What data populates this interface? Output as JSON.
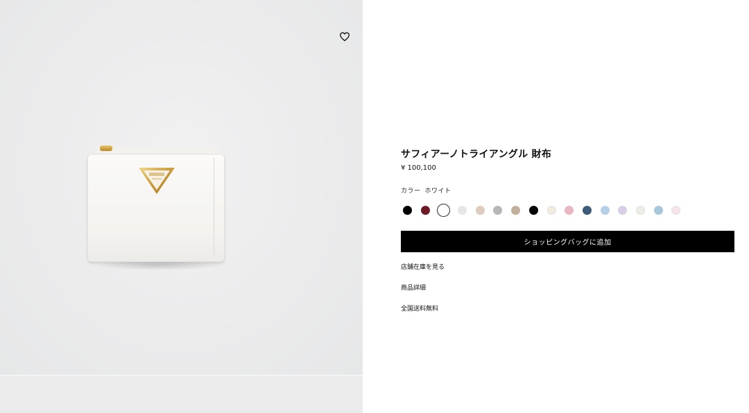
{
  "gallery": {
    "wishlist_icon": "heart-outline-icon"
  },
  "product": {
    "name": "サフィアーノトライアングル 財布",
    "price": "¥ 100,100",
    "color_label": "カラー",
    "color_value": "ホワイト",
    "swatches": [
      {
        "color": "#000000",
        "selected": false
      },
      {
        "color": "#6b1a26",
        "selected": false
      },
      {
        "color": "#ffffff",
        "selected": true
      },
      {
        "color": "#e6e6e6",
        "selected": false
      },
      {
        "color": "#ddcbbd",
        "selected": false
      },
      {
        "color": "#b7b7b7",
        "selected": false
      },
      {
        "color": "#c3b09c",
        "selected": false
      },
      {
        "color": "#050505",
        "selected": false
      },
      {
        "color": "#f1ebdf",
        "selected": false
      },
      {
        "color": "#e9b7c1",
        "selected": false
      },
      {
        "color": "#3c5a79",
        "selected": false
      },
      {
        "color": "#b7cfe8",
        "selected": false
      },
      {
        "color": "#d8cfe6",
        "selected": false
      },
      {
        "color": "#eeece6",
        "selected": false
      },
      {
        "color": "#a6c7dc",
        "selected": false
      },
      {
        "color": "#f6e5e8",
        "selected": false
      }
    ],
    "add_to_bag_label": "ショッピングバッグに追加",
    "links": {
      "store_stock": "店舗在庫を見る",
      "product_details": "商品詳細",
      "free_shipping": "全国送料無料"
    }
  },
  "colors": {
    "button_bg": "#000000",
    "button_text": "#ffffff",
    "gallery_bg": "#ececed"
  }
}
